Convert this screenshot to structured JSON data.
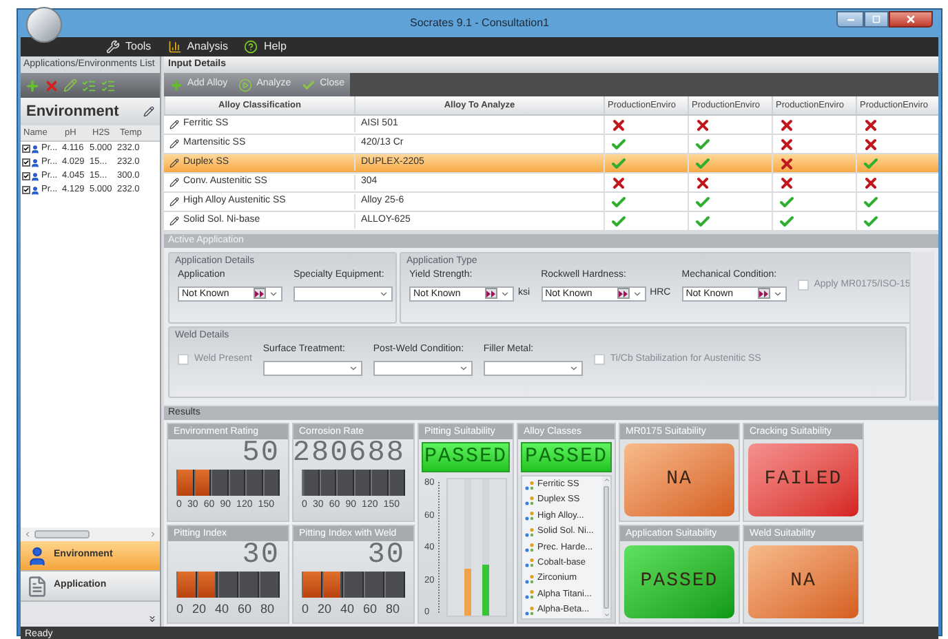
{
  "window": {
    "title": "Socrates 9.1 - Consultation1"
  },
  "menu": [
    {
      "label": "Tools",
      "kind": "tools"
    },
    {
      "label": "Analysis",
      "kind": "analysis"
    },
    {
      "label": "Help",
      "kind": "help"
    }
  ],
  "left_pane": {
    "title": "Applications/Environments List",
    "heading": "Environment",
    "columns": [
      "Name",
      "pH",
      "H2S",
      "Temp"
    ],
    "rows": [
      {
        "checked": true,
        "cells": [
          "Pr...",
          "4.116",
          "5.000",
          "232.0"
        ]
      },
      {
        "checked": true,
        "cells": [
          "Pr...",
          "4.029",
          "15...",
          "232.0"
        ]
      },
      {
        "checked": true,
        "cells": [
          "Pr...",
          "4.045",
          "15...",
          "300.0"
        ]
      },
      {
        "checked": true,
        "cells": [
          "Pr...",
          "4.129",
          "5.000",
          "232.0"
        ]
      }
    ],
    "nav": [
      {
        "label": "Environment",
        "kind": "environment",
        "selected": true
      },
      {
        "label": "Application",
        "kind": "application",
        "selected": false
      }
    ]
  },
  "input_details": {
    "title": "Input Details",
    "toolbar": [
      {
        "label": "Add Alloy",
        "kind": "add"
      },
      {
        "label": "Analyze",
        "kind": "analyze"
      },
      {
        "label": "Close",
        "kind": "close"
      }
    ],
    "columns": [
      "Alloy Classification",
      "Alloy To Analyze",
      "ProductionEnviro",
      "ProductionEnviro",
      "ProductionEnviro",
      "ProductionEnviro"
    ],
    "rows": [
      {
        "selected": false,
        "cells": [
          "Ferritic SS",
          "AISI 501"
        ],
        "passed": [
          false,
          false,
          false,
          false
        ]
      },
      {
        "selected": false,
        "cells": [
          "Martensitic SS",
          "420/13 Cr"
        ],
        "passed": [
          true,
          true,
          false,
          false
        ]
      },
      {
        "selected": true,
        "cells": [
          "Duplex SS",
          "DUPLEX-2205"
        ],
        "passed": [
          true,
          true,
          false,
          true
        ]
      },
      {
        "selected": false,
        "cells": [
          "Conv. Austenitic SS",
          "304"
        ],
        "passed": [
          false,
          false,
          false,
          false
        ]
      },
      {
        "selected": false,
        "cells": [
          "High Alloy Austenitic SS",
          "Alloy 25-6"
        ],
        "passed": [
          true,
          true,
          true,
          true
        ]
      },
      {
        "selected": false,
        "cells": [
          "Solid Sol. Ni-base",
          "ALLOY-625"
        ],
        "passed": [
          true,
          true,
          true,
          true
        ]
      }
    ]
  },
  "active_application": {
    "title": "Active Application",
    "application_details": {
      "title": "Application Details",
      "items": [
        {
          "kind": "picker",
          "label": "Application",
          "value": "Not Known"
        },
        {
          "kind": "select",
          "label": "Specialty Equipment:"
        }
      ]
    },
    "application_type": {
      "title": "Application Type",
      "items": [
        {
          "kind": "picker",
          "label": "Yield Strength:",
          "value": "Not Known",
          "unit": "ksi"
        },
        {
          "kind": "picker",
          "label": "Rockwell Hardness:",
          "value": "Not Known",
          "unit": "HRC"
        },
        {
          "kind": "picker",
          "label": "Mechanical Condition:",
          "value": "Not Known"
        },
        {
          "kind": "checkbox",
          "label": "Apply MR0175/ISO-15",
          "checked": false,
          "disabled": true
        }
      ]
    },
    "weld_details": {
      "title": "Weld Details",
      "items": [
        {
          "kind": "checkbox",
          "label": "Weld Present",
          "checked": false,
          "disabled": true
        },
        {
          "kind": "select",
          "label": "Surface Treatment:"
        },
        {
          "kind": "select",
          "label": "Post-Weld Condition:"
        },
        {
          "kind": "select",
          "label": "Filler Metal:"
        },
        {
          "kind": "checkbox",
          "label": "Ti/Cb Stabilization for Austenitic SS",
          "checked": false,
          "disabled": true
        }
      ]
    }
  },
  "results": {
    "title": "Results",
    "gauges": [
      {
        "title": "Environment Rating",
        "reading": "50",
        "level": 0.32,
        "ticks": [
          "0",
          "30",
          "60",
          "90",
          "120",
          "150"
        ]
      },
      {
        "title": "Corrosion Rate",
        "reading": "280688",
        "level": 0,
        "ticks": [
          "0",
          "30",
          "60",
          "90",
          "120",
          "150"
        ]
      },
      {
        "title": "Pitting Index",
        "reading": "30",
        "level": 0.37,
        "ticks": [
          "0",
          "20",
          "40",
          "60",
          "80"
        ]
      },
      {
        "title": "Pitting Index with Weld",
        "reading": "30",
        "level": 0.37,
        "ticks": [
          "0",
          "20",
          "40",
          "60",
          "80"
        ]
      }
    ],
    "pitting_suitability": {
      "title": "Pitting Suitability",
      "status": "PASSED",
      "ticks": [
        "80",
        "60",
        "40",
        "20",
        "0"
      ],
      "bars": [
        {
          "level": 0.34,
          "color": "#f2a24e"
        },
        {
          "level": 0.37,
          "color": "#37c437"
        }
      ]
    },
    "alloy_classes": {
      "title": "Alloy Classes",
      "status": "PASSED",
      "items": [
        "Ferritic SS",
        "Duplex SS",
        "High Alloy...",
        "Solid Sol. Ni...",
        "Prec. Harde...",
        "Cobalt-base",
        "Zirconium",
        "Alpha Titani...",
        "Alpha-Beta..."
      ]
    },
    "suitability": [
      {
        "title": "MR0175 Suitability",
        "status": "NA",
        "kind": "na"
      },
      {
        "title": "Cracking Suitability",
        "status": "FAILED",
        "kind": "failed"
      },
      {
        "title": "Application Suitability",
        "status": "PASSED",
        "kind": "passed"
      },
      {
        "title": "Weld Suitability",
        "status": "NA",
        "kind": "na"
      }
    ]
  },
  "status_bar": "Ready"
}
